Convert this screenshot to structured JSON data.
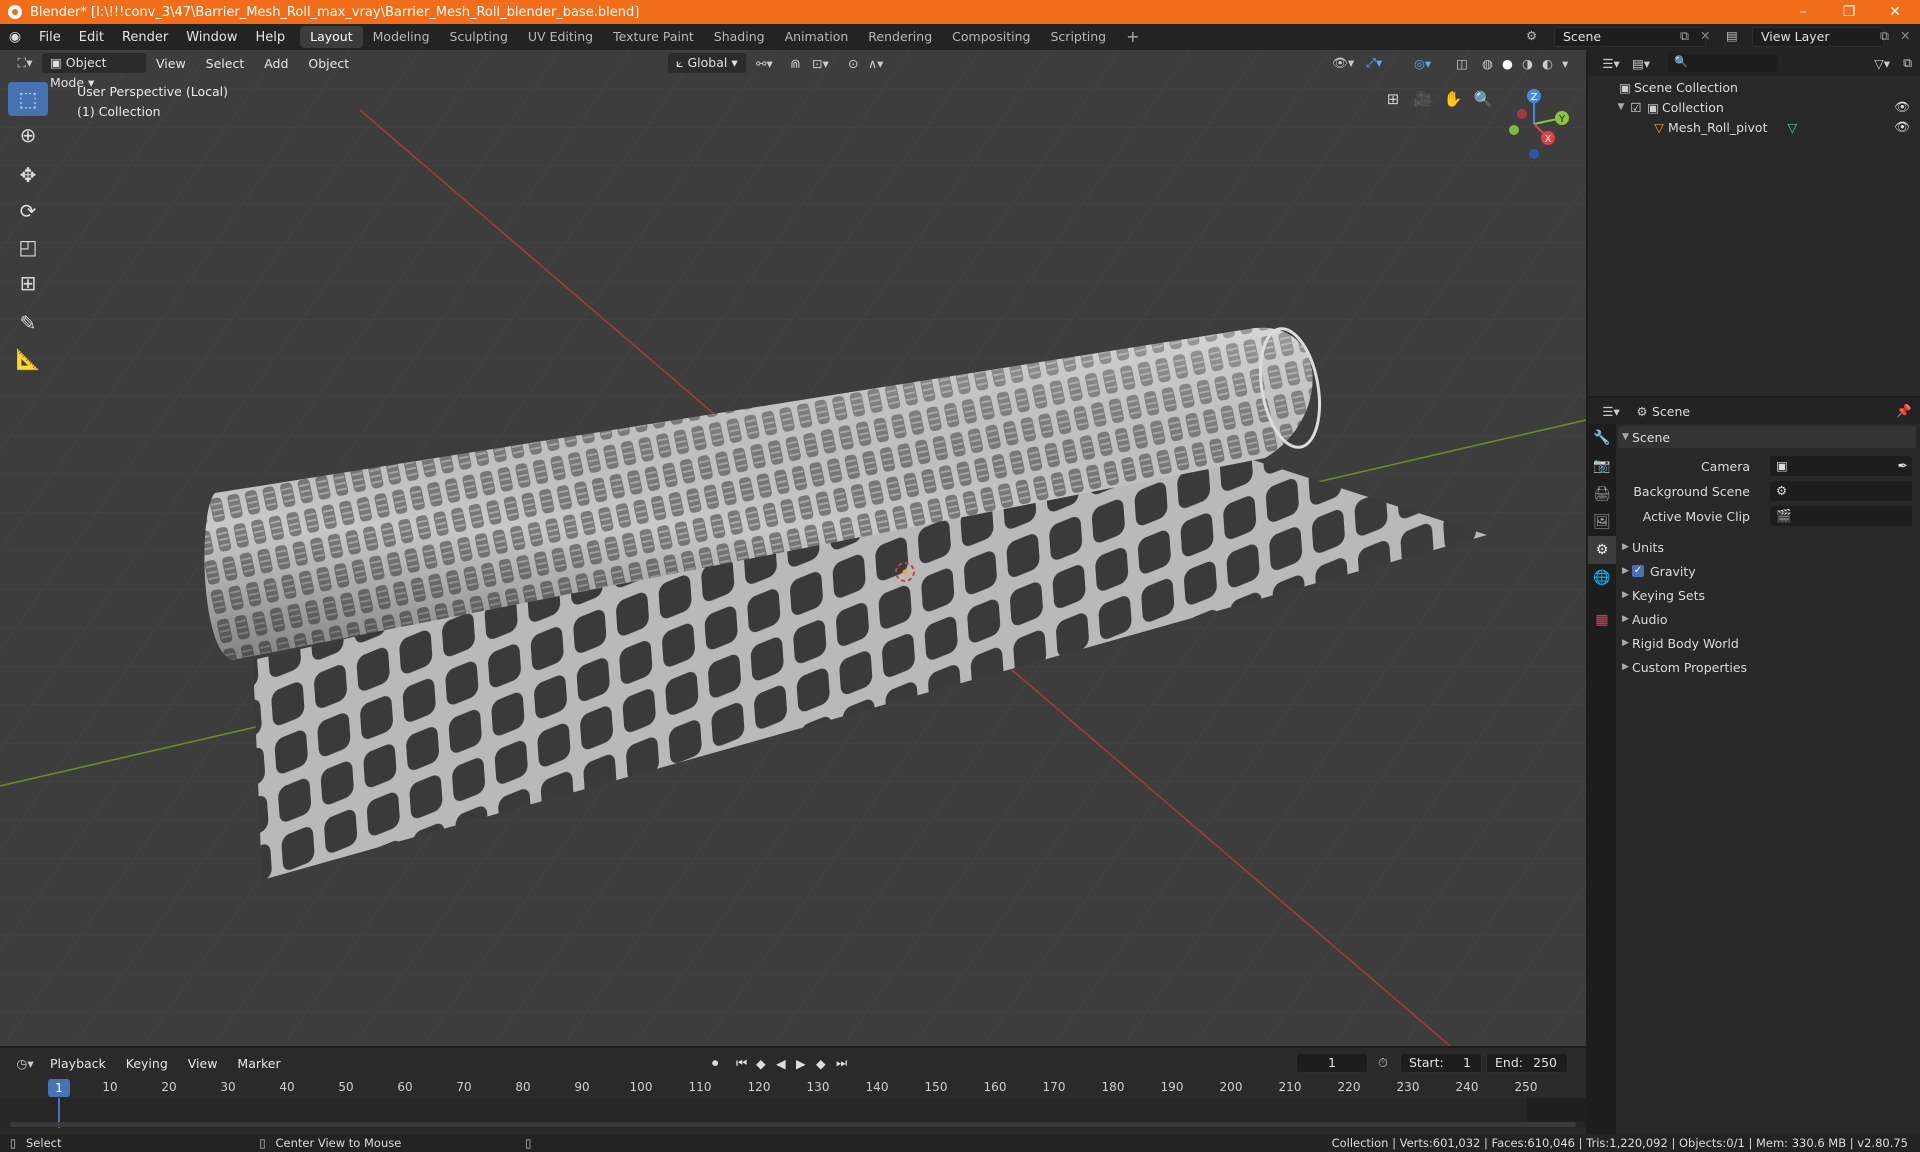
{
  "window": {
    "title": "Blender* [I:\\!!!conv_3\\47\\Barrier_Mesh_Roll_max_vray\\Barrier_Mesh_Roll_blender_base.blend]",
    "controls": [
      "–",
      "❐",
      "✕"
    ]
  },
  "topbar": {
    "menus": [
      "File",
      "Edit",
      "Render",
      "Window",
      "Help"
    ],
    "workspaces": [
      "Layout",
      "Modeling",
      "Sculpting",
      "UV Editing",
      "Texture Paint",
      "Shading",
      "Animation",
      "Rendering",
      "Compositing",
      "Scripting"
    ],
    "active_workspace": "Layout",
    "scene_name": "Scene",
    "view_layer": "View Layer"
  },
  "viewport": {
    "mode": "Object Mode",
    "menus": [
      "View",
      "Select",
      "Add",
      "Object"
    ],
    "orientation": "Global",
    "overlay_line1": "User Perspective (Local)",
    "overlay_line2": "(1) Collection",
    "gizmo": {
      "x": "X",
      "y": "Y",
      "z": "Z"
    }
  },
  "outliner": {
    "root": "Scene Collection",
    "collection": "Collection",
    "object": "Mesh_Roll_pivot"
  },
  "properties": {
    "context": "Scene",
    "section": "Scene",
    "fields": {
      "camera": "Camera",
      "background_scene": "Background Scene",
      "active_movie_clip": "Active Movie Clip"
    },
    "panels": [
      "Units",
      "Gravity",
      "Keying Sets",
      "Audio",
      "Rigid Body World",
      "Custom Properties"
    ]
  },
  "timeline": {
    "menus": [
      "Playback",
      "Keying",
      "View",
      "Marker"
    ],
    "current_frame": "1",
    "start_label": "Start:",
    "start": "1",
    "end_label": "End:",
    "end": "250",
    "playhead": "1",
    "ticks": [
      "10",
      "20",
      "30",
      "40",
      "50",
      "60",
      "70",
      "80",
      "90",
      "100",
      "110",
      "120",
      "130",
      "140",
      "150",
      "160",
      "170",
      "180",
      "190",
      "200",
      "210",
      "220",
      "230",
      "240",
      "250"
    ]
  },
  "statusbar": {
    "left1": "Select",
    "left2": "Center View to Mouse",
    "stats": "Collection | Verts:601,032 | Faces:610,046 | Tris:1,220,092 | Objects:0/1 | Mem: 330.6 MB | v2.80.75"
  },
  "colors": {
    "title_bar": "#f26d1a",
    "accent": "#4772b3",
    "x_axis": "#e0404a",
    "y_axis": "#8bc53f",
    "z_axis": "#4a88e0"
  }
}
